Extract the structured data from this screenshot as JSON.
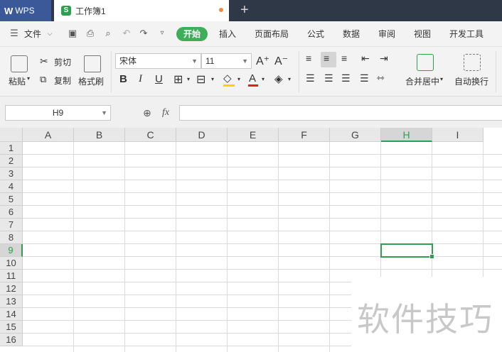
{
  "titlebar": {
    "app_tab_label": "WPS",
    "doc_tab_label": "工作簿1",
    "doc_icon_letter": "S",
    "new_tab_symbol": "+"
  },
  "menubar": {
    "file_label": "文件",
    "tabs": [
      "开始",
      "插入",
      "页面布局",
      "公式",
      "数据",
      "审阅",
      "视图",
      "开发工具"
    ],
    "active_tab": "开始",
    "active_color": "#3fae5b"
  },
  "ribbon": {
    "paste_label": "粘贴",
    "cut_label": "剪切",
    "copy_label": "复制",
    "format_painter_label": "格式刷",
    "font_name": "宋体",
    "font_size": "11",
    "bold": "B",
    "italic": "I",
    "underline": "U",
    "grow_font": "A⁺",
    "shrink_font": "A⁻",
    "font_color_letter": "A",
    "merge_label": "合并居中",
    "wrap_label": "自动换行"
  },
  "formula_bar": {
    "name_box": "H9",
    "fx_label": "fx",
    "formula": ""
  },
  "sheet": {
    "columns": [
      "A",
      "B",
      "C",
      "D",
      "E",
      "F",
      "G",
      "H",
      "I"
    ],
    "rows": [
      "1",
      "2",
      "3",
      "4",
      "5",
      "6",
      "7",
      "8",
      "9",
      "10",
      "11",
      "12",
      "13",
      "14",
      "15",
      "16"
    ],
    "selected_column": "H",
    "selected_row": "9",
    "accent_color": "#2e9e4f"
  },
  "watermark_text": "软件技巧"
}
